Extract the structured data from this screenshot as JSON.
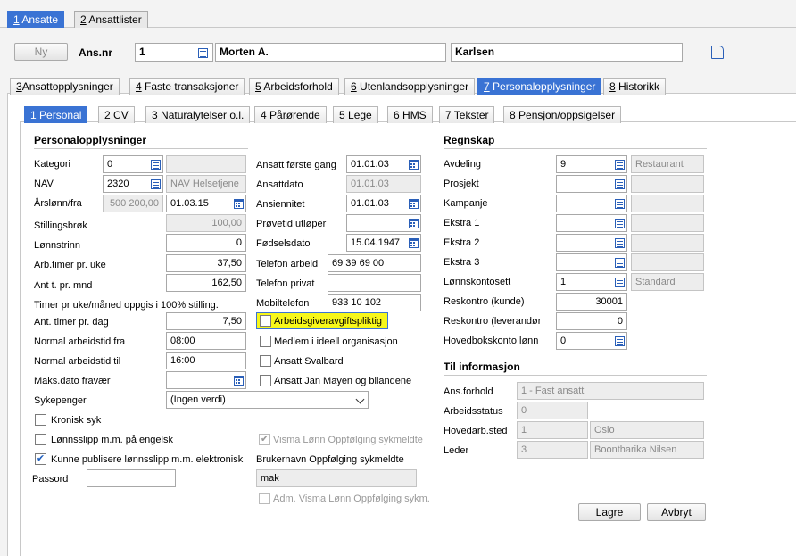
{
  "top_tabs": [
    {
      "num": "1",
      "label": " Ansatte"
    },
    {
      "num": "2",
      "label": " Ansattlister"
    }
  ],
  "header": {
    "new_button": "Ny",
    "ans_nr_label": "Ans.nr",
    "ans_nr": "1",
    "first_name": "Morten A.",
    "last_name": "Karlsen"
  },
  "tabs_level2": [
    {
      "num": "3",
      "label": "Ansattopplysninger"
    },
    {
      "num": "4",
      "label": " Faste transaksjoner"
    },
    {
      "num": "5",
      "label": " Arbeidsforhold"
    },
    {
      "num": "6",
      "label": " Utenlandsopplysninger"
    },
    {
      "num": "7",
      "label": " Personalopplysninger"
    },
    {
      "num": "8",
      "label": " Historikk"
    }
  ],
  "tabs_level3": [
    {
      "num": "1",
      "label": " Personal"
    },
    {
      "num": "2",
      "label": " CV"
    },
    {
      "num": "3",
      "label": " Naturalytelser o.l."
    },
    {
      "num": "4",
      "label": " Pårørende"
    },
    {
      "num": "5",
      "label": " Lege"
    },
    {
      "num": "6",
      "label": " HMS"
    },
    {
      "num": "7",
      "label": " Tekster"
    },
    {
      "num": "8",
      "label": " Pensjon/oppsigelser"
    }
  ],
  "personal": {
    "title": "Personalopplysninger",
    "kategori_label": "Kategori",
    "kategori": "0",
    "nav_label": "NAV",
    "nav": "2320",
    "nav_name": "NAV Helsetjene",
    "arslonn_label": "Årslønn/fra",
    "arslonn": "500 200,00",
    "arslonn_fra": "01.03.15",
    "stillingsbrok_label": "Stillingsbrøk",
    "stillingsbrok": "100,00",
    "lonnstrinn_label": "Lønnstrinn",
    "lonnstrinn": "0",
    "arbtimer_label": "Arb.timer pr. uke",
    "arbtimer": "37,50",
    "anttpr_label": "Ant t. pr. mnd",
    "anttpr": "162,50",
    "note": "Timer pr uke/måned oppgis i 100% stilling.",
    "anttimer_dag_label": "Ant. timer pr. dag",
    "anttimer_dag": "7,50",
    "normal_fra_label": "Normal arbeidstid fra",
    "normal_fra": "08:00",
    "normal_til_label": "Normal arbeidstid til",
    "normal_til": "16:00",
    "maks_label": "Maks.dato fravær",
    "maks": "",
    "sykepenger_label": "Sykepenger",
    "sykepenger": "(Ingen verdi)",
    "kronisk_label": "Kronisk syk",
    "lonnsslipp_engelsk_label": "Lønnsslipp m.m. på engelsk",
    "kunne_publisere_label": "Kunne publisere lønnsslipp m.m. elektronisk",
    "passord_label": "Passord",
    "passord": ""
  },
  "middle": {
    "forste_gang_label": "Ansatt første gang",
    "forste_gang": "01.01.03",
    "ansattdato_label": "Ansattdato",
    "ansattdato": "01.01.03",
    "ansiennitet_label": "Ansiennitet",
    "ansiennitet": "01.01.03",
    "provetid_label": "Prøvetid utløper",
    "provetid": "",
    "fodselsdato_label": "Fødselsdato",
    "fodselsdato": "15.04.1947",
    "telefon_arbeid_label": "Telefon arbeid",
    "telefon_arbeid": "69 39 69 00",
    "telefon_privat_label": "Telefon privat",
    "telefon_privat": "",
    "mobil_label": "Mobiltelefon",
    "mobil": "933 10 102",
    "arbeidsgiveravgift_label": "Arbeidsgiveravgiftspliktig",
    "medlem_label": "Medlem i ideell organisasjon",
    "svalbard_label": "Ansatt Svalbard",
    "jan_mayen_label": "Ansatt Jan Mayen og bilandene",
    "visma_oppfolging_label": "Visma Lønn Oppfølging sykmeldte",
    "brukernavn_label": "Brukernavn Oppfølging sykmeldte",
    "brukernavn": "mak",
    "adm_label": "Adm. Visma Lønn Oppfølging sykm."
  },
  "regnskap": {
    "title": "Regnskap",
    "avdeling_label": "Avdeling",
    "avdeling": "9",
    "avdeling_name": "Restaurant",
    "prosjekt_label": "Prosjekt",
    "kampanje_label": "Kampanje",
    "ekstra1_label": "Ekstra 1",
    "ekstra2_label": "Ekstra 2",
    "ekstra3_label": "Ekstra 3",
    "lonnskontosett_label": "Lønnskontosett",
    "lonnskontosett": "1",
    "lonnskontosett_name": "Standard",
    "reskontro_kunde_label": "Reskontro (kunde)",
    "reskontro_kunde": "30001",
    "reskontro_lev_label": "Reskontro (leverandør",
    "reskontro_lev": "0",
    "hovedbok_label": "Hovedbokskonto lønn",
    "hovedbok": "0"
  },
  "info": {
    "title": "Til informasjon",
    "ansforhold_label": "Ans.forhold",
    "ansforhold": "1 - Fast ansatt",
    "arbeidsstatus_label": "Arbeidsstatus",
    "arbeidsstatus": "0",
    "hovedarb_label": "Hovedarb.sted",
    "hovedarb": "1",
    "hovedarb_name": "Oslo",
    "leder_label": "Leder",
    "leder": "3",
    "leder_name": "Boontharika Nilsen"
  },
  "buttons": {
    "lagre": "Lagre",
    "avbryt": "Avbryt"
  },
  "colors": {
    "accent": "#3a73d4",
    "highlight": "#f7f71a"
  }
}
